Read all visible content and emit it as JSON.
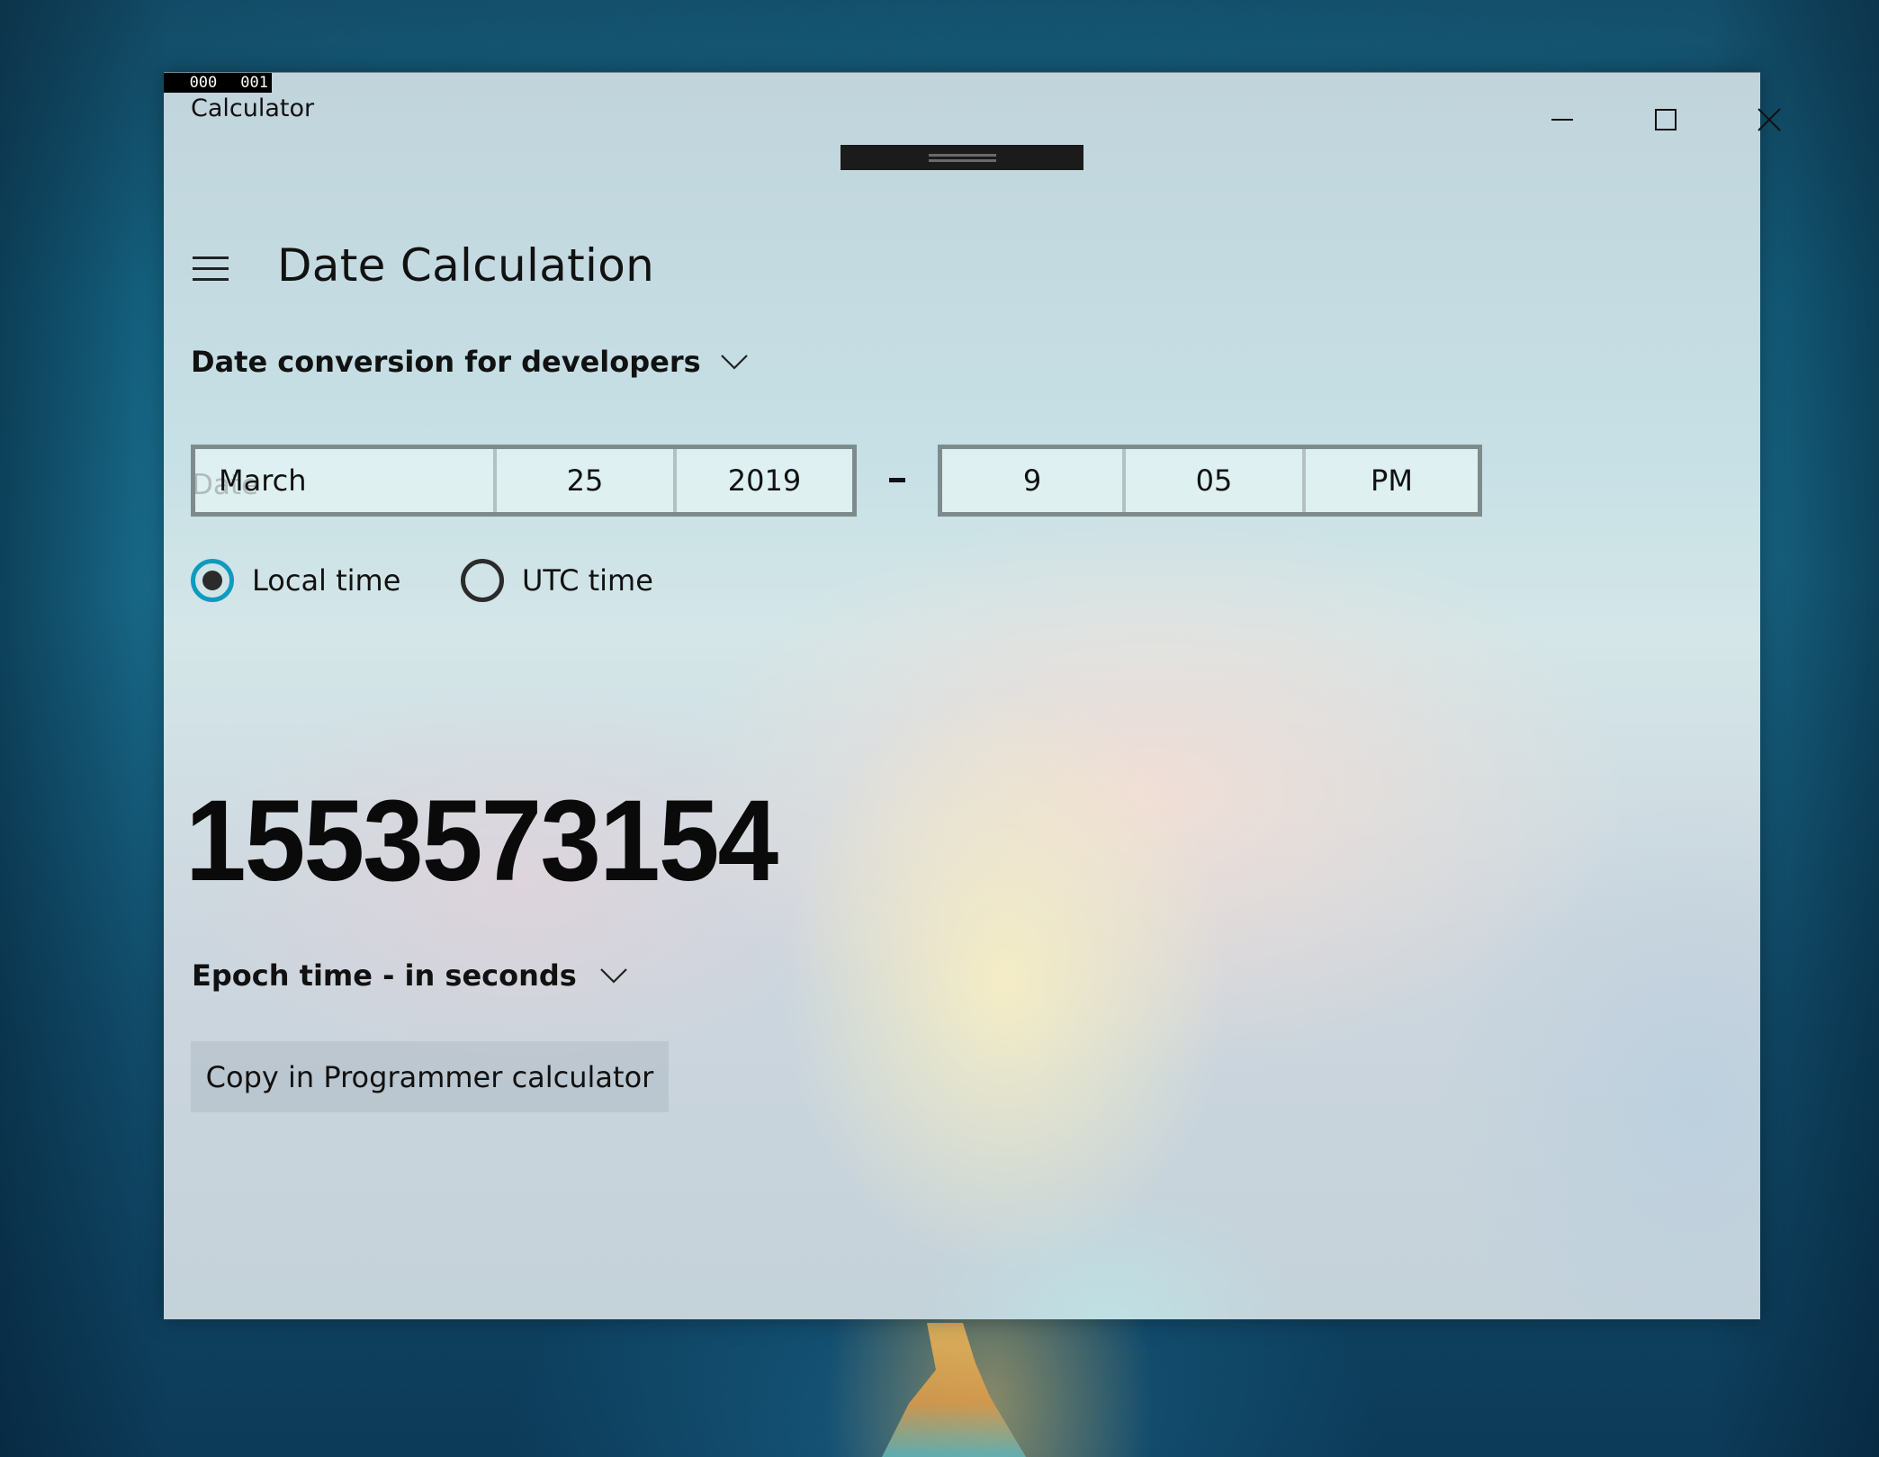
{
  "desktop": {
    "wallpaper": "forest river illustration (blue/teal with golden river)"
  },
  "window": {
    "debug_overlay": [
      "000",
      "001"
    ],
    "title": "Calculator",
    "caption_buttons": {
      "minimize_icon": "minimize-icon",
      "maximize_icon": "maximize-icon",
      "close_icon": "close-icon"
    }
  },
  "header": {
    "menu_icon": "hamburger-menu-icon",
    "title": "Date Calculation"
  },
  "mode": {
    "selected": "Date conversion for developers",
    "icon": "chevron-down-icon"
  },
  "date_section": {
    "label": "Date",
    "date_picker": {
      "month": "March",
      "day": "25",
      "year": "2019"
    },
    "separator": "-",
    "time_picker": {
      "hour": "9",
      "minute": "05",
      "period": "PM"
    }
  },
  "timezone": {
    "options": [
      {
        "label": "Local time",
        "selected": true
      },
      {
        "label": "UTC time",
        "selected": false
      }
    ]
  },
  "result": {
    "value": "1553573154",
    "unit": "Epoch time - in seconds",
    "unit_icon": "chevron-down-icon"
  },
  "actions": {
    "copy_label": "Copy in Programmer calculator"
  },
  "colors": {
    "accent": "#0f9bbd",
    "picker_border": "#7e8b8c",
    "text": "#111111",
    "gripper": "#1b1b1b"
  }
}
